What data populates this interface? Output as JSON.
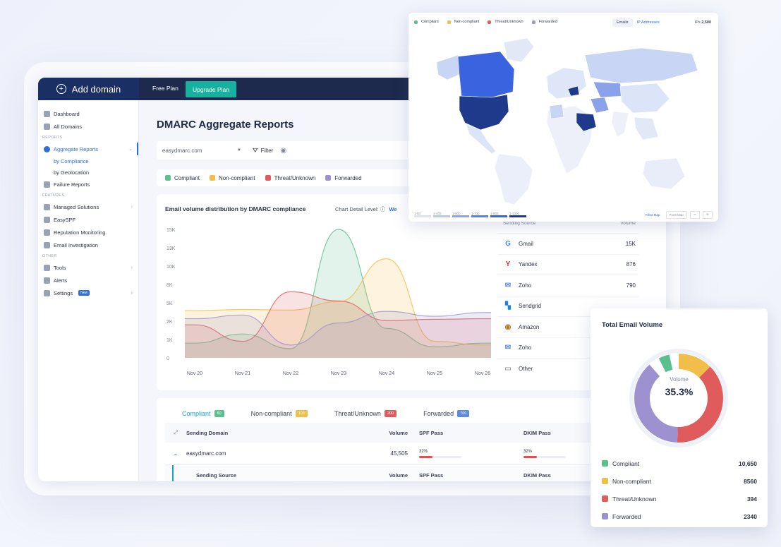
{
  "topbar": {
    "add_domain": "Add domain",
    "free_plan": "Free Plan",
    "upgrade": "Upgrade Plan"
  },
  "sidebar": {
    "items_top": [
      {
        "label": "Dashboard"
      },
      {
        "label": "All Domains"
      }
    ],
    "reports_section": "REPORTS",
    "reports": {
      "label": "Aggregate Reports",
      "subs": [
        "by Compliance",
        "by Geolocation"
      ],
      "failure": "Failure Reports"
    },
    "features_section": "FEATURES",
    "features": [
      "Managed Solutions",
      "EasySPF",
      "Reputation Monitoring",
      "Email Investigation"
    ],
    "other_section": "OTHER",
    "other": [
      "Tools",
      "Alerts",
      "Settings"
    ],
    "new_badge": "New"
  },
  "main": {
    "title": "DMARC Aggregate Reports",
    "domain_select": "easydmarc.com",
    "filter": "Filter",
    "legend": [
      {
        "label": "Compliant",
        "color": "#5cbf8e"
      },
      {
        "label": "Non-compliant",
        "color": "#f2be4a"
      },
      {
        "label": "Threat/Unknown",
        "color": "#e05c5c"
      },
      {
        "label": "Forwarded",
        "color": "#9d92cf"
      }
    ],
    "chart_title": "Email volume distribution by DMARC compliance",
    "chart_detail_label": "Chart Detail Level:",
    "chart_detail_value": "We"
  },
  "chart_data": {
    "type": "area",
    "title": "Email volume distribution by DMARC compliance",
    "xlabel": "",
    "ylabel": "",
    "x": [
      "Nov 20",
      "Nov 21",
      "Nov 22",
      "Nov 23",
      "Nov 24",
      "Nov 25",
      "Nov 26"
    ],
    "y_ticks": [
      "0",
      "1K",
      "2K",
      "5K",
      "8K",
      "10K",
      "13K",
      "15K"
    ],
    "y_tick_values": [
      0,
      1000,
      2000,
      5000,
      8000,
      10000,
      13000,
      15000
    ],
    "ylim": [
      0,
      15000
    ],
    "series": [
      {
        "name": "Compliant",
        "color": "#5cbf8e",
        "values": [
          800,
          1300,
          500,
          15200,
          1600,
          600,
          800
        ]
      },
      {
        "name": "Non-compliant",
        "color": "#f2be4a",
        "values": [
          3700,
          3900,
          3800,
          5200,
          11200,
          900,
          700
        ]
      },
      {
        "name": "Threat/Unknown",
        "color": "#e05c5c",
        "values": [
          1800,
          900,
          6800,
          5300,
          2100,
          2300,
          2400
        ]
      },
      {
        "name": "Forwarded",
        "color": "#9d92cf",
        "values": [
          2400,
          3000,
          700,
          1900,
          3600,
          2800,
          3400
        ]
      }
    ],
    "grid": false
  },
  "sources": {
    "header_source": "Sending Source",
    "header_volume": "Volume",
    "rows": [
      {
        "name": "Gmail",
        "volume": "15K",
        "icon": "google-icon"
      },
      {
        "name": "Yandex",
        "volume": "876",
        "icon": "yandex-icon"
      },
      {
        "name": "Zoho",
        "volume": "790",
        "icon": "envelope-icon"
      },
      {
        "name": "Sendgrid",
        "volume": "",
        "icon": "sendgrid-icon"
      },
      {
        "name": "Amazon",
        "volume": "",
        "icon": "amazon-icon"
      },
      {
        "name": "Zoho",
        "volume": "",
        "icon": "envelope-icon"
      },
      {
        "name": "Other",
        "volume": "",
        "icon": "other-icon"
      }
    ]
  },
  "table": {
    "tabs": [
      {
        "label": "Compliant",
        "count": "60",
        "color": "#5cbf8e"
      },
      {
        "label": "Non-compliant",
        "count": "103",
        "color": "#f2be4a"
      },
      {
        "label": "Threat/Unknown",
        "count": "200",
        "color": "#e05c5c"
      },
      {
        "label": "Forwarded",
        "count": "700",
        "color": "#5b8ae0"
      }
    ],
    "headers": {
      "domain": "Sending Domain",
      "volume": "Volume",
      "spf": "SPF Pass",
      "dkim": "DKIM Pass"
    },
    "row": {
      "domain": "easydmarc.com",
      "volume": "45,505",
      "spf": "32%",
      "spf_pct": 0.32,
      "dkim": "32%",
      "dkim_pct": 0.32
    },
    "subheaders": {
      "source": "Sending Source",
      "volume": "Volume",
      "spf": "SPF Pass",
      "dkim": "DKIM Pass"
    }
  },
  "map": {
    "legend": [
      "Compliant",
      "Non-compliant",
      "Threat/Unknown",
      "Forwarded"
    ],
    "toggle": [
      "Emails",
      "IP Addresses"
    ],
    "ips_label": "IPs",
    "ips_value": "2,500",
    "scale": [
      "1-50",
      "1-400",
      "1-600",
      "1-700",
      "1-800",
      "1-1000"
    ],
    "buttons": [
      "Filled Map",
      "Point Map"
    ],
    "zoom_out": "−",
    "zoom_in": "+"
  },
  "volume": {
    "title": "Total Email Volume",
    "center_label": "Volume",
    "center_value": "35.3%",
    "items": [
      {
        "label": "Compliant",
        "value": "10,650",
        "color": "#5cbf8e"
      },
      {
        "label": "Non-compliant",
        "value": "8560",
        "color": "#f2be4a"
      },
      {
        "label": "Threat/Unknown",
        "value": "394",
        "color": "#e05c5c"
      },
      {
        "label": "Forwarded",
        "value": "2340",
        "color": "#9d92cf"
      }
    ],
    "donut_shares": [
      0.04,
      0.2,
      0.38,
      0.38
    ]
  }
}
